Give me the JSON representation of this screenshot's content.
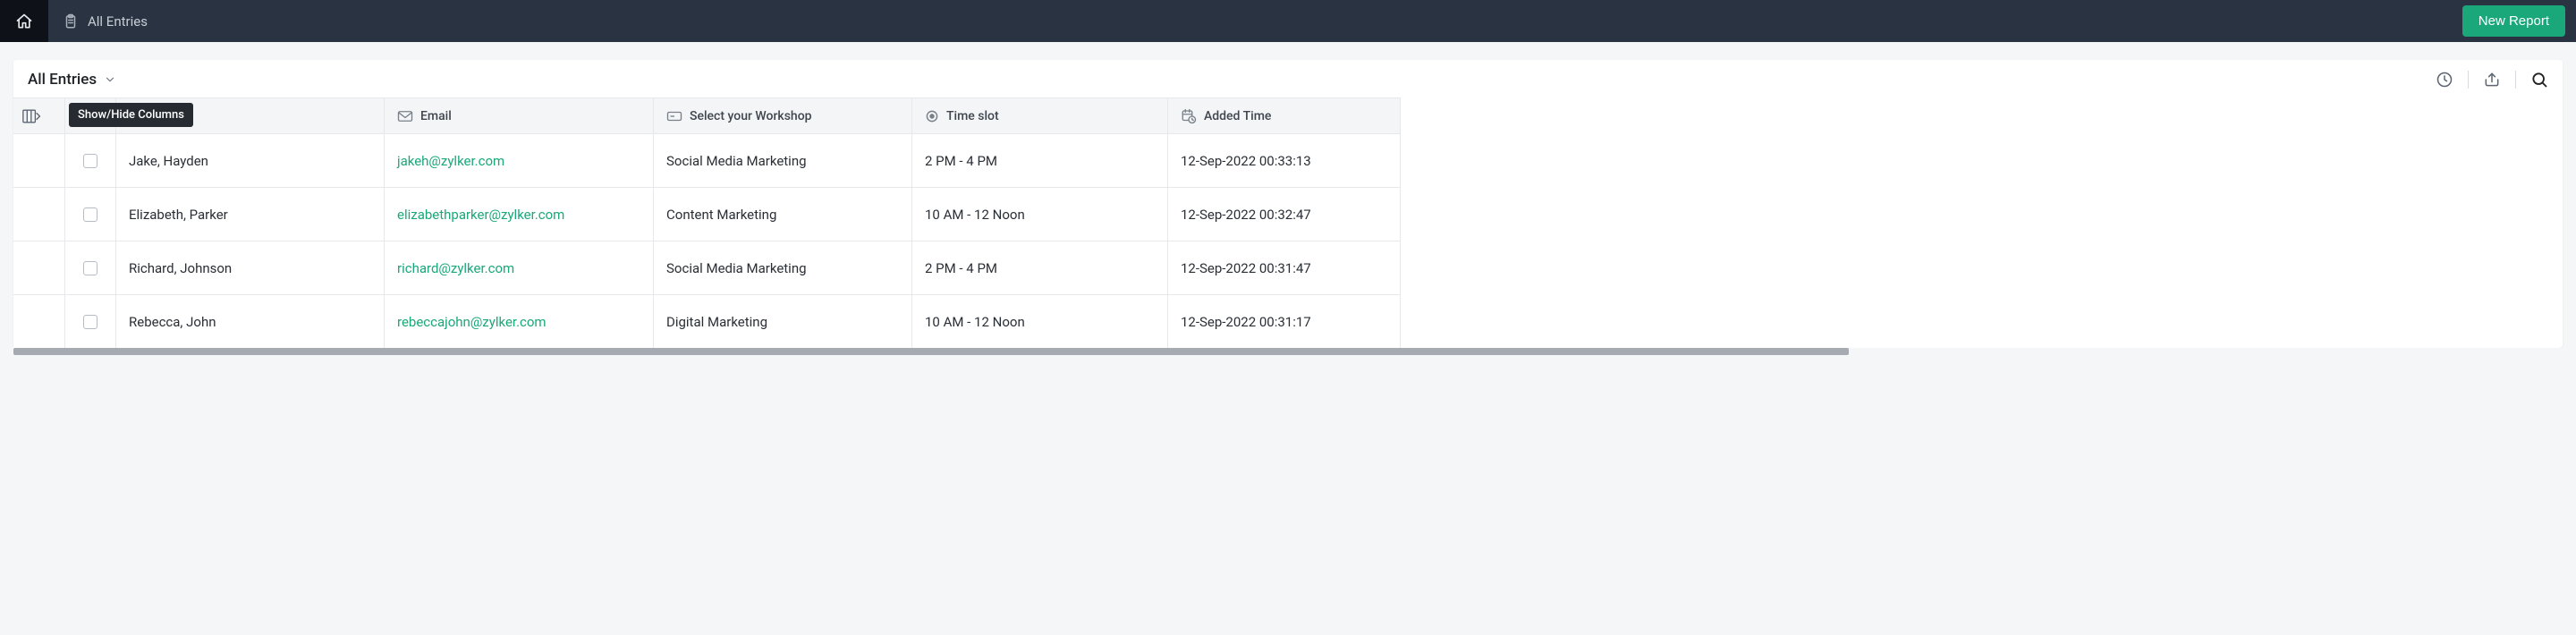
{
  "topbar": {
    "breadcrumb_label": "All Entries",
    "new_report_label": "New Report"
  },
  "view": {
    "title": "All Entries"
  },
  "tooltip": {
    "show_hide_columns": "Show/Hide Columns"
  },
  "columns": {
    "name": "",
    "email": "Email",
    "workshop": "Select your Workshop",
    "timeslot": "Time slot",
    "added_time": "Added Time"
  },
  "rows": [
    {
      "name": "Jake, Hayden",
      "email": "jakeh@zylker.com",
      "workshop": "Social Media Marketing",
      "timeslot": "2 PM - 4 PM",
      "added_time": "12-Sep-2022 00:33:13"
    },
    {
      "name": "Elizabeth, Parker",
      "email": "elizabethparker@zylker.com",
      "workshop": "Content Marketing",
      "timeslot": "10 AM - 12 Noon",
      "added_time": "12-Sep-2022 00:32:47"
    },
    {
      "name": "Richard, Johnson",
      "email": "richard@zylker.com",
      "workshop": "Social Media Marketing",
      "timeslot": "2 PM - 4 PM",
      "added_time": "12-Sep-2022 00:31:47"
    },
    {
      "name": "Rebecca, John",
      "email": "rebeccajohn@zylker.com",
      "workshop": "Digital Marketing",
      "timeslot": "10 AM - 12 Noon",
      "added_time": "12-Sep-2022 00:31:17"
    }
  ]
}
